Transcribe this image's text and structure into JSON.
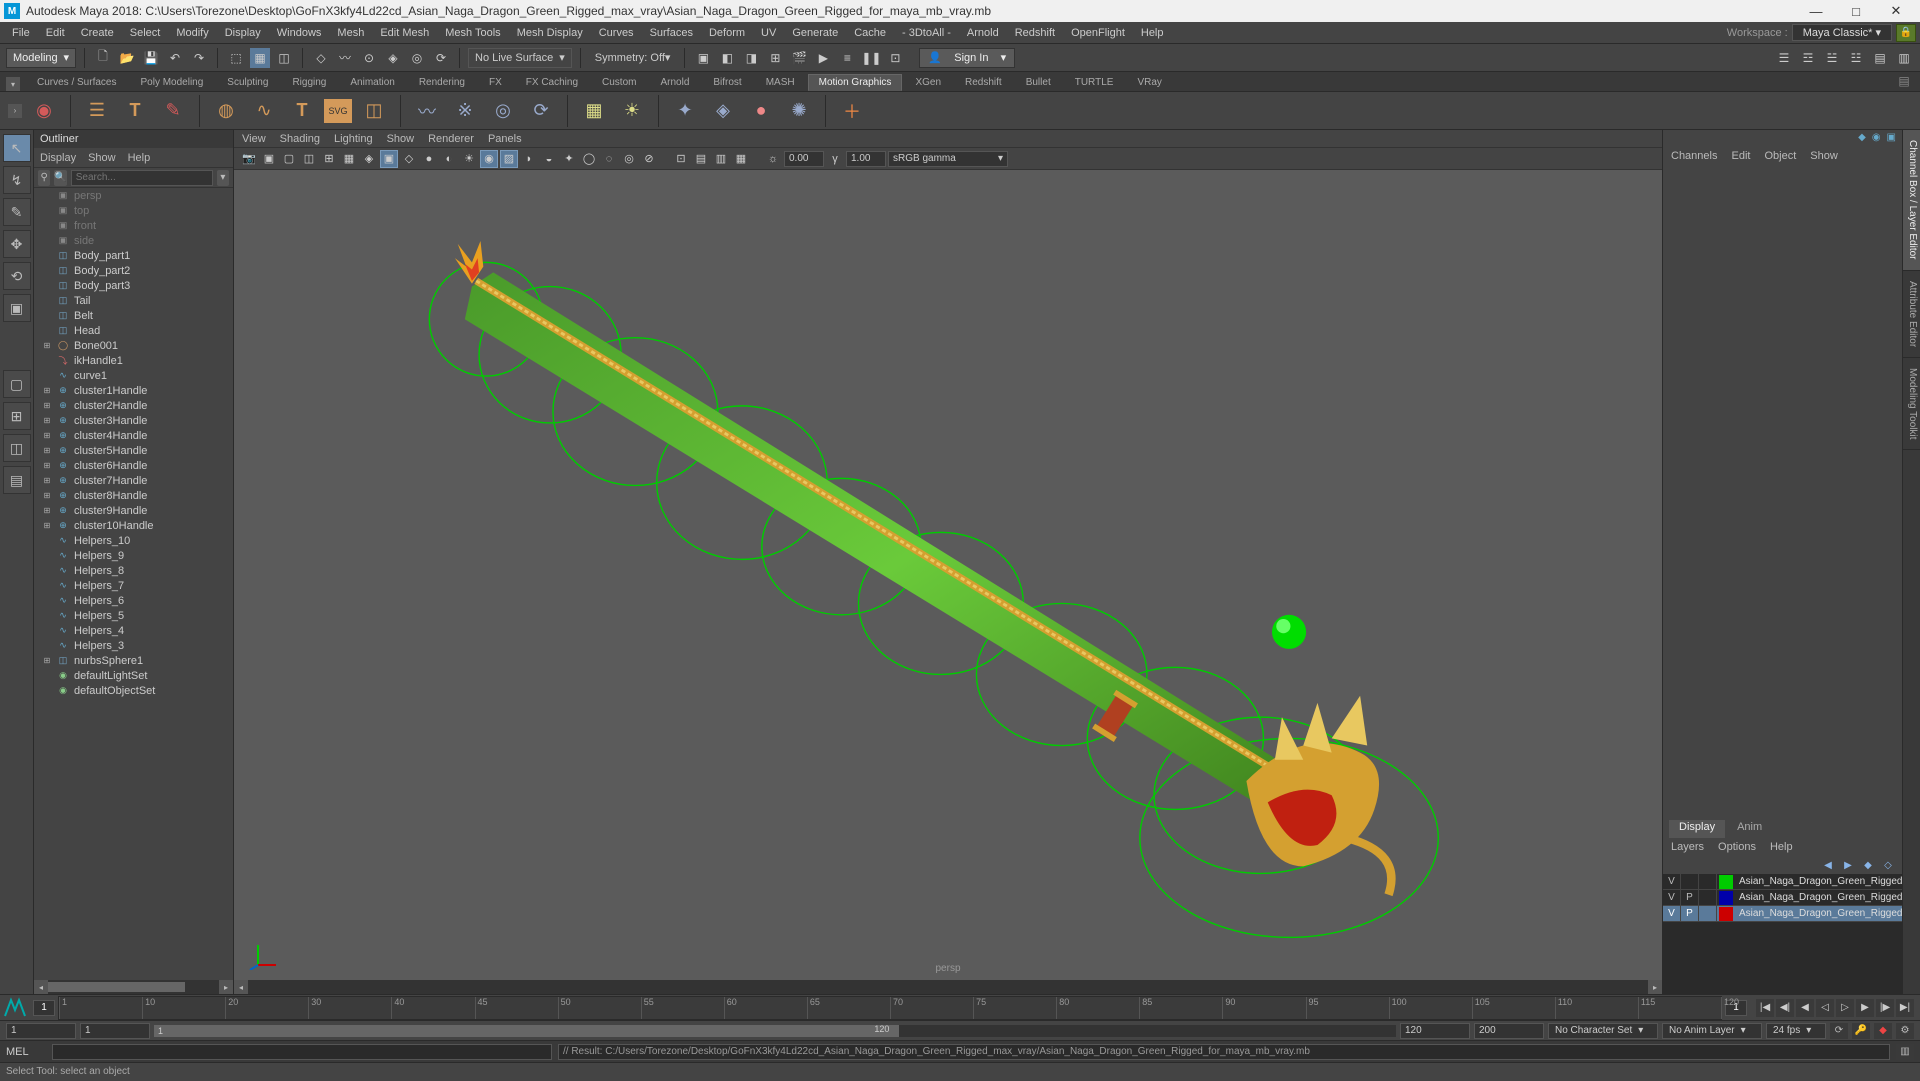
{
  "window": {
    "app_icon": "M",
    "title": "Autodesk Maya 2018: C:\\Users\\Torezone\\Desktop\\GoFnX3kfy4Ld22cd_Asian_Naga_Dragon_Green_Rigged_max_vray\\Asian_Naga_Dragon_Green_Rigged_for_maya_mb_vray.mb",
    "min": "—",
    "max": "□",
    "close": "✕"
  },
  "menubar": {
    "items": [
      "File",
      "Edit",
      "Create",
      "Select",
      "Modify",
      "Display",
      "Windows",
      "Mesh",
      "Edit Mesh",
      "Mesh Tools",
      "Mesh Display",
      "Curves",
      "Surfaces",
      "Deform",
      "UV",
      "Generate",
      "Cache",
      "- 3DtoAll -",
      "Arnold",
      "Redshift",
      "OpenFlight",
      "Help"
    ],
    "workspace_label": "Workspace :",
    "workspace_value": "Maya Classic*"
  },
  "toolbar1": {
    "mode": "Modeling",
    "no_live_surface": "No Live Surface",
    "symmetry": "Symmetry: Off",
    "sign_in": "Sign In"
  },
  "shelftabs": [
    "Curves / Surfaces",
    "Poly Modeling",
    "Sculpting",
    "Rigging",
    "Animation",
    "Rendering",
    "FX",
    "FX Caching",
    "Custom",
    "Arnold",
    "Bifrost",
    "MASH",
    "Motion Graphics",
    "XGen",
    "Redshift",
    "Bullet",
    "TURTLE",
    "VRay"
  ],
  "shelftab_active": 12,
  "outliner": {
    "title": "Outliner",
    "menu": [
      "Display",
      "Show",
      "Help"
    ],
    "search_placeholder": "Search...",
    "items": [
      {
        "indent": 0,
        "exp": "",
        "icon": "cam",
        "label": "persp",
        "dim": true
      },
      {
        "indent": 0,
        "exp": "",
        "icon": "cam",
        "label": "top",
        "dim": true
      },
      {
        "indent": 0,
        "exp": "",
        "icon": "cam",
        "label": "front",
        "dim": true
      },
      {
        "indent": 0,
        "exp": "",
        "icon": "cam",
        "label": "side",
        "dim": true
      },
      {
        "indent": 0,
        "exp": "",
        "icon": "mesh",
        "label": "Body_part1"
      },
      {
        "indent": 0,
        "exp": "",
        "icon": "mesh",
        "label": "Body_part2"
      },
      {
        "indent": 0,
        "exp": "",
        "icon": "mesh",
        "label": "Body_part3"
      },
      {
        "indent": 0,
        "exp": "",
        "icon": "mesh",
        "label": "Tail"
      },
      {
        "indent": 0,
        "exp": "",
        "icon": "mesh",
        "label": "Belt"
      },
      {
        "indent": 0,
        "exp": "",
        "icon": "mesh",
        "label": "Head"
      },
      {
        "indent": 0,
        "exp": "+",
        "icon": "joint",
        "label": "Bone001"
      },
      {
        "indent": 0,
        "exp": "",
        "icon": "ik",
        "label": "ikHandle1"
      },
      {
        "indent": 0,
        "exp": "",
        "icon": "curve",
        "label": "curve1"
      },
      {
        "indent": 0,
        "exp": "+",
        "icon": "cluster",
        "label": "cluster1Handle"
      },
      {
        "indent": 0,
        "exp": "+",
        "icon": "cluster",
        "label": "cluster2Handle"
      },
      {
        "indent": 0,
        "exp": "+",
        "icon": "cluster",
        "label": "cluster3Handle"
      },
      {
        "indent": 0,
        "exp": "+",
        "icon": "cluster",
        "label": "cluster4Handle"
      },
      {
        "indent": 0,
        "exp": "+",
        "icon": "cluster",
        "label": "cluster5Handle"
      },
      {
        "indent": 0,
        "exp": "+",
        "icon": "cluster",
        "label": "cluster6Handle"
      },
      {
        "indent": 0,
        "exp": "+",
        "icon": "cluster",
        "label": "cluster7Handle"
      },
      {
        "indent": 0,
        "exp": "+",
        "icon": "cluster",
        "label": "cluster8Handle"
      },
      {
        "indent": 0,
        "exp": "+",
        "icon": "cluster",
        "label": "cluster9Handle"
      },
      {
        "indent": 0,
        "exp": "+",
        "icon": "cluster",
        "label": "cluster10Handle"
      },
      {
        "indent": 0,
        "exp": "",
        "icon": "curve",
        "label": "Helpers_10"
      },
      {
        "indent": 0,
        "exp": "",
        "icon": "curve",
        "label": "Helpers_9"
      },
      {
        "indent": 0,
        "exp": "",
        "icon": "curve",
        "label": "Helpers_8"
      },
      {
        "indent": 0,
        "exp": "",
        "icon": "curve",
        "label": "Helpers_7"
      },
      {
        "indent": 0,
        "exp": "",
        "icon": "curve",
        "label": "Helpers_6"
      },
      {
        "indent": 0,
        "exp": "",
        "icon": "curve",
        "label": "Helpers_5"
      },
      {
        "indent": 0,
        "exp": "",
        "icon": "curve",
        "label": "Helpers_4"
      },
      {
        "indent": 0,
        "exp": "",
        "icon": "curve",
        "label": "Helpers_3"
      },
      {
        "indent": 0,
        "exp": "+",
        "icon": "mesh",
        "label": "nurbsSphere1"
      },
      {
        "indent": 0,
        "exp": "",
        "icon": "set",
        "label": "defaultLightSet"
      },
      {
        "indent": 0,
        "exp": "",
        "icon": "set",
        "label": "defaultObjectSet"
      }
    ]
  },
  "viewport": {
    "menu": [
      "View",
      "Shading",
      "Lighting",
      "Show",
      "Renderer",
      "Panels"
    ],
    "exposure": "0.00",
    "gamma_val": "1.00",
    "gamma_mode": "sRGB gamma",
    "camera_label": "persp"
  },
  "rightpanel": {
    "tabs": [
      "Channels",
      "Edit",
      "Object",
      "Show"
    ],
    "disp_tabs": [
      "Display",
      "Anim"
    ],
    "layer_tabs": [
      "Layers",
      "Options",
      "Help"
    ],
    "layers": [
      {
        "v": "V",
        "p": "",
        "color": "#00cc00",
        "name": "Asian_Naga_Dragon_Green_Rigged_Helpe",
        "sel": false
      },
      {
        "v": "V",
        "p": "P",
        "color": "#0000aa",
        "name": "Asian_Naga_Dragon_Green_Rigged_bones",
        "sel": false
      },
      {
        "v": "V",
        "p": "P",
        "color": "#cc0000",
        "name": "Asian_Naga_Dragon_Green_Rigged",
        "sel": true
      }
    ],
    "side_tabs": [
      "Channel Box / Layer Editor",
      "Attribute Editor",
      "Modeling Toolkit"
    ]
  },
  "timeline": {
    "start_vis": "1",
    "end_vis": "1",
    "ticks": [
      "1",
      "10",
      "20",
      "30",
      "40",
      "45",
      "50",
      "55",
      "60",
      "65",
      "70",
      "75",
      "80",
      "85",
      "90",
      "95",
      "100",
      "105",
      "110",
      "115",
      "120"
    ]
  },
  "range": {
    "start": "1",
    "inner_start": "1",
    "inner_label": "1",
    "inner_end": "120",
    "end": "120",
    "outer_end": "200",
    "char_set": "No Character Set",
    "anim_layer": "No Anim Layer",
    "fps": "24 fps"
  },
  "cmd": {
    "mel": "MEL",
    "result": "// Result: C:/Users/Torezone/Desktop/GoFnX3kfy4Ld22cd_Asian_Naga_Dragon_Green_Rigged_max_vray/Asian_Naga_Dragon_Green_Rigged_for_maya_mb_vray.mb"
  },
  "help": "Select Tool: select an object"
}
